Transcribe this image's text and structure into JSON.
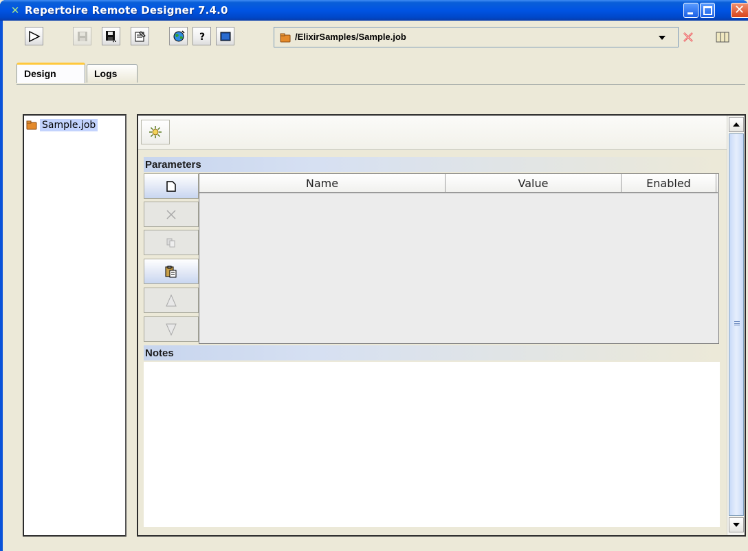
{
  "window": {
    "title": "Repertoire Remote Designer 7.4.0",
    "title_icon": "elixir-logo-icon"
  },
  "toolbar": {
    "buttons": [
      {
        "name": "run-icon",
        "enabled": true
      },
      {
        "name": "save-icon",
        "enabled": false
      },
      {
        "name": "save-as-icon",
        "enabled": true
      },
      {
        "name": "properties-icon",
        "enabled": true
      },
      {
        "name": "globe-icon",
        "enabled": true
      },
      {
        "name": "help-icon",
        "enabled": true
      },
      {
        "name": "console-icon",
        "enabled": true
      }
    ],
    "path": "/ElixirSamples/Sample.job"
  },
  "tabs": [
    {
      "label": "Design",
      "active": true
    },
    {
      "label": "Logs",
      "active": false
    }
  ],
  "tree": {
    "items": [
      {
        "label": "Sample.job",
        "selected": true
      }
    ]
  },
  "main": {
    "parameters_title": "Parameters",
    "notes_title": "Notes",
    "columns": [
      "Name",
      "Value",
      "Enabled"
    ],
    "side_buttons": [
      {
        "name": "new-icon",
        "enabled": true
      },
      {
        "name": "delete-icon",
        "enabled": false
      },
      {
        "name": "copy-icon",
        "enabled": false
      },
      {
        "name": "paste-icon",
        "enabled": true
      },
      {
        "name": "move-up-icon",
        "enabled": false
      },
      {
        "name": "move-down-icon",
        "enabled": false
      }
    ]
  }
}
